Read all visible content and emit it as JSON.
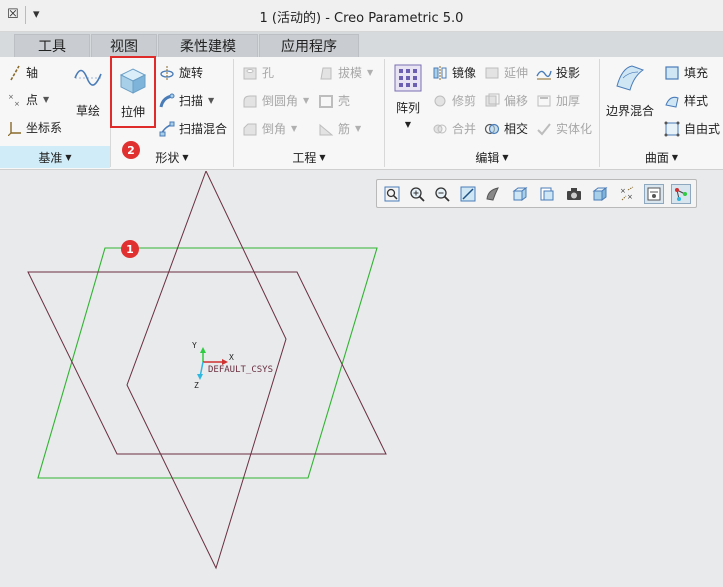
{
  "titlebar": {
    "title": "1 (活动的) - Creo Parametric 5.0",
    "close_glyph": "☒",
    "menu_glyph": "▾"
  },
  "tabs": [
    {
      "label": "工具"
    },
    {
      "label": "视图"
    },
    {
      "label": "柔性建模"
    },
    {
      "label": "应用程序"
    }
  ],
  "groups": {
    "datum": {
      "label": "基准",
      "items": {
        "axis": "轴",
        "point": "点",
        "csys": "坐标系",
        "sketch": "草绘"
      }
    },
    "shapes": {
      "label": "形状",
      "items": {
        "extrude": "拉伸",
        "revolve": "旋转",
        "sweep": "扫描",
        "swept_blend": "扫描混合"
      }
    },
    "engineering": {
      "label": "工程",
      "items": {
        "hole": "孔",
        "draft": "拔模",
        "round": "倒圆角",
        "shell": "壳",
        "chamfer": "倒角",
        "rib": "筋"
      }
    },
    "editing": {
      "label": "编辑",
      "items": {
        "pattern": "阵列",
        "mirror": "镜像",
        "extend": "延伸",
        "project": "投影",
        "trim": "修剪",
        "offset": "偏移",
        "thicken": "加厚",
        "merge": "合并",
        "intersect": "相交",
        "solidify": "实体化"
      }
    },
    "surfaces": {
      "label": "曲面",
      "items": {
        "boundary_blend": "边界混合",
        "fill": "填充",
        "style": "样式",
        "freestyle": "自由式"
      }
    }
  },
  "annotations": {
    "badge1": "1",
    "badge2": "2"
  },
  "csys": {
    "label": "DEFAULT_CSYS",
    "x": "X",
    "y": "Y",
    "z": "Z"
  },
  "view_toolbar": [
    "refit-icon",
    "zoom-in-icon",
    "zoom-out-icon",
    "repaint-icon",
    "display-style-icon",
    "saved-orientations-icon",
    "view-manager-icon",
    "perspective-icon",
    "annotation-display-icon",
    "spin-center-icon",
    "datum-display-icon",
    "sketcher-display-icon"
  ],
  "colors": {
    "accent": "#d0ecf8",
    "highlight": "#e02b2b",
    "sketch_green": "#31b431",
    "sketch_maroon": "#6b2f40"
  }
}
